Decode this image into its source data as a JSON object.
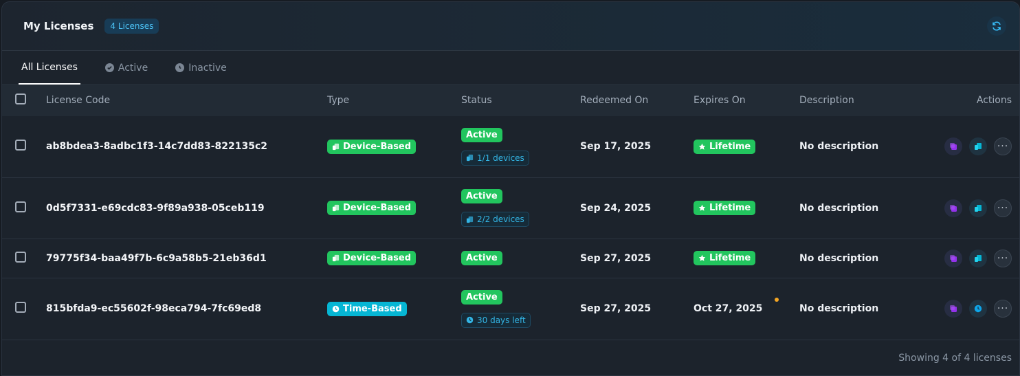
{
  "header": {
    "title": "My Licenses",
    "count_badge": "4 Licenses"
  },
  "tabs": [
    {
      "label": "All Licenses",
      "icon": "none"
    },
    {
      "label": "Active",
      "icon": "check-circle-icon"
    },
    {
      "label": "Inactive",
      "icon": "clock-icon"
    }
  ],
  "columns": {
    "license_code": "License Code",
    "type": "Type",
    "status": "Status",
    "redeemed_on": "Redeemed On",
    "expires_on": "Expires On",
    "description": "Description",
    "actions": "Actions"
  },
  "rows": [
    {
      "code": "ab8bdea3-8adbc1f3-14c7dd83-822135c2",
      "type": "Device-Based",
      "status": "Active",
      "sub": "1/1 devices",
      "redeemed": "Sep 17, 2025",
      "expires": "Lifetime",
      "description": "No description"
    },
    {
      "code": "0d5f7331-e69cdc83-9f89a938-05ceb119",
      "type": "Device-Based",
      "status": "Active",
      "sub": "2/2 devices",
      "redeemed": "Sep 24, 2025",
      "expires": "Lifetime",
      "description": "No description"
    },
    {
      "code": "79775f34-baa49f7b-6c9a58b5-21eb36d1",
      "type": "Device-Based",
      "status": "Active",
      "sub": "",
      "redeemed": "Sep 27, 2025",
      "expires": "Lifetime",
      "description": "No description"
    },
    {
      "code": "815bfda9-ec55602f-98eca794-7fc69ed8",
      "type": "Time-Based",
      "status": "Active",
      "sub": "30 days left",
      "redeemed": "Sep 27, 2025",
      "expires": "Oct 27, 2025",
      "description": "No description"
    }
  ],
  "footer": {
    "text": "Showing 4 of 4 licenses"
  },
  "colors": {
    "green": "#22c55e",
    "cyan": "#06b6d4",
    "purple": "#9333ea",
    "accent_blue": "#33b5e5"
  }
}
